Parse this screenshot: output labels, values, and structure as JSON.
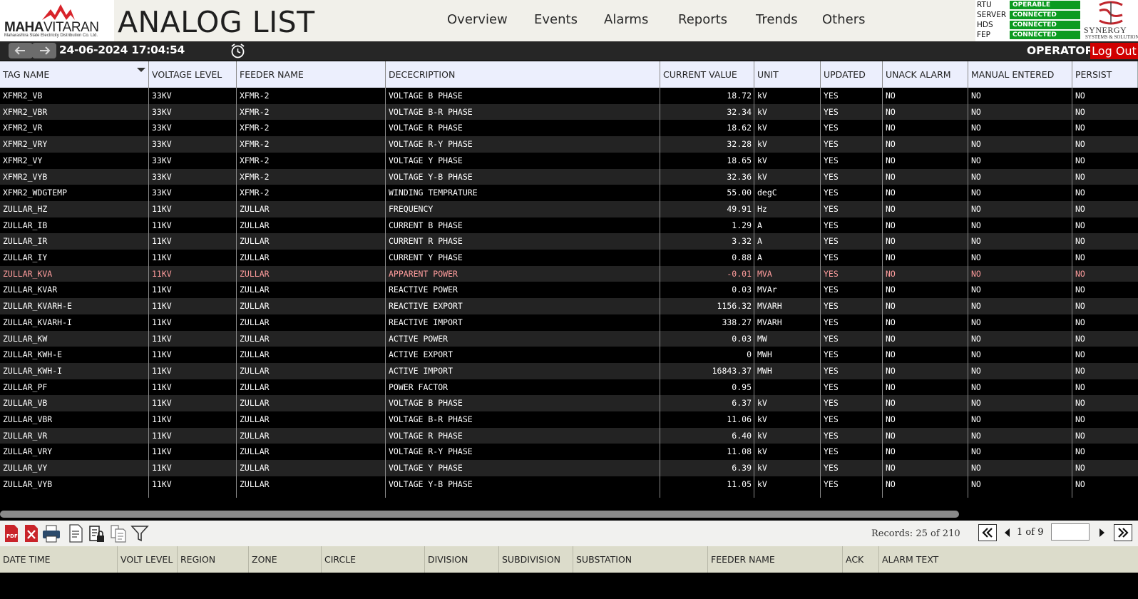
{
  "header": {
    "logo": {
      "brand_bold": "MAHA",
      "brand_light": "VITARAN",
      "subtitle": "Maharashtra State Electricity Distribution Co. Ltd."
    },
    "page_title": "ANALOG LIST",
    "nav": [
      "Overview",
      "Events",
      "Alarms",
      "Reports",
      "Trends",
      "Others"
    ],
    "status": [
      {
        "label": "RTU",
        "value": "OPERABLE"
      },
      {
        "label": "SERVER",
        "value": "CONNECTED"
      },
      {
        "label": "HDS",
        "value": "CONNECTED"
      },
      {
        "label": "FEP",
        "value": "CONNECTED"
      }
    ],
    "vendor": {
      "name": "Synergy",
      "subtitle": "Systems & Solutions"
    }
  },
  "subbar": {
    "datetime": "24-06-2024 17:04:54",
    "user_role": "OPERATOR",
    "logout_label": "Log Out"
  },
  "table": {
    "columns": [
      "TAG NAME",
      "VOLTAGE LEVEL",
      "FEEDER NAME",
      "DECECRIPTION",
      "CURRENT VALUE",
      "UNIT",
      "UPDATED",
      "UNACK ALARM",
      "MANUAL ENTERED",
      "PERSIST"
    ],
    "rows": [
      [
        "XFMR2_VB",
        "33KV",
        "XFMR-2",
        "VOLTAGE B PHASE",
        "18.72",
        "kV",
        "YES",
        "NO",
        "NO",
        "NO"
      ],
      [
        "XFMR2_VBR",
        "33KV",
        "XFMR-2",
        "VOLTAGE B-R PHASE",
        "32.34",
        "kV",
        "YES",
        "NO",
        "NO",
        "NO"
      ],
      [
        "XFMR2_VR",
        "33KV",
        "XFMR-2",
        "VOLTAGE R PHASE",
        "18.62",
        "kV",
        "YES",
        "NO",
        "NO",
        "NO"
      ],
      [
        "XFMR2_VRY",
        "33KV",
        "XFMR-2",
        "VOLTAGE R-Y PHASE",
        "32.28",
        "kV",
        "YES",
        "NO",
        "NO",
        "NO"
      ],
      [
        "XFMR2_VY",
        "33KV",
        "XFMR-2",
        "VOLTAGE Y PHASE",
        "18.65",
        "kV",
        "YES",
        "NO",
        "NO",
        "NO"
      ],
      [
        "XFMR2_VYB",
        "33KV",
        "XFMR-2",
        "VOLTAGE Y-B PHASE",
        "32.36",
        "kV",
        "YES",
        "NO",
        "NO",
        "NO"
      ],
      [
        "XFMR2_WDGTEMP",
        "33KV",
        "XFMR-2",
        "WINDING TEMPRATURE",
        "55.00",
        "degC",
        "YES",
        "NO",
        "NO",
        "NO"
      ],
      [
        "ZULLAR_HZ",
        "11KV",
        "ZULLAR",
        "FREQUENCY",
        "49.91",
        "Hz",
        "YES",
        "NO",
        "NO",
        "NO"
      ],
      [
        "ZULLAR_IB",
        "11KV",
        "ZULLAR",
        "CURRENT B PHASE",
        "1.29",
        "A",
        "YES",
        "NO",
        "NO",
        "NO"
      ],
      [
        "ZULLAR_IR",
        "11KV",
        "ZULLAR",
        "CURRENT R PHASE",
        "3.32",
        "A",
        "YES",
        "NO",
        "NO",
        "NO"
      ],
      [
        "ZULLAR_IY",
        "11KV",
        "ZULLAR",
        "CURRENT Y PHASE",
        "0.88",
        "A",
        "YES",
        "NO",
        "NO",
        "NO"
      ],
      [
        "ZULLAR_KVA",
        "11KV",
        "ZULLAR",
        "APPARENT POWER",
        "-0.01",
        "MVA",
        "YES",
        "NO",
        "NO",
        "NO"
      ],
      [
        "ZULLAR_KVAR",
        "11KV",
        "ZULLAR",
        "REACTIVE POWER",
        "0.03",
        "MVAr",
        "YES",
        "NO",
        "NO",
        "NO"
      ],
      [
        "ZULLAR_KVARH-E",
        "11KV",
        "ZULLAR",
        "REACTIVE EXPORT",
        "1156.32",
        "MVARH",
        "YES",
        "NO",
        "NO",
        "NO"
      ],
      [
        "ZULLAR_KVARH-I",
        "11KV",
        "ZULLAR",
        "REACTIVE IMPORT",
        "338.27",
        "MVARH",
        "YES",
        "NO",
        "NO",
        "NO"
      ],
      [
        "ZULLAR_KW",
        "11KV",
        "ZULLAR",
        "ACTIVE POWER",
        "0.03",
        "MW",
        "YES",
        "NO",
        "NO",
        "NO"
      ],
      [
        "ZULLAR_KWH-E",
        "11KV",
        "ZULLAR",
        "ACTIVE EXPORT",
        "0",
        "MWH",
        "YES",
        "NO",
        "NO",
        "NO"
      ],
      [
        "ZULLAR_KWH-I",
        "11KV",
        "ZULLAR",
        "ACTIVE IMPORT",
        "16843.37",
        "MWH",
        "YES",
        "NO",
        "NO",
        "NO"
      ],
      [
        "ZULLAR_PF",
        "11KV",
        "ZULLAR",
        "POWER FACTOR",
        "0.95",
        "",
        "YES",
        "NO",
        "NO",
        "NO"
      ],
      [
        "ZULLAR_VB",
        "11KV",
        "ZULLAR",
        "VOLTAGE B PHASE",
        "6.37",
        "kV",
        "YES",
        "NO",
        "NO",
        "NO"
      ],
      [
        "ZULLAR_VBR",
        "11KV",
        "ZULLAR",
        "VOLTAGE B-R PHASE",
        "11.06",
        "kV",
        "YES",
        "NO",
        "NO",
        "NO"
      ],
      [
        "ZULLAR_VR",
        "11KV",
        "ZULLAR",
        "VOLTAGE R PHASE",
        "6.40",
        "kV",
        "YES",
        "NO",
        "NO",
        "NO"
      ],
      [
        "ZULLAR_VRY",
        "11KV",
        "ZULLAR",
        "VOLTAGE R-Y PHASE",
        "11.08",
        "kV",
        "YES",
        "NO",
        "NO",
        "NO"
      ],
      [
        "ZULLAR_VY",
        "11KV",
        "ZULLAR",
        "VOLTAGE Y PHASE",
        "6.39",
        "kV",
        "YES",
        "NO",
        "NO",
        "NO"
      ],
      [
        "ZULLAR_VYB",
        "11KV",
        "ZULLAR",
        "VOLTAGE Y-B PHASE",
        "11.05",
        "kV",
        "YES",
        "NO",
        "NO",
        "NO"
      ]
    ],
    "alarm_row_index": 11,
    "alarm_row_color": "#ff9d9d"
  },
  "toolbar": {
    "icons": [
      "pdf-icon",
      "excel-icon",
      "print-icon",
      "report-icon",
      "lock-report-icon",
      "copy-icon",
      "filter-icon"
    ],
    "records_label": "Records:",
    "records_shown": "25",
    "records_of": "of",
    "records_total": "210",
    "page_current": "1",
    "page_of": "of",
    "page_total": "9",
    "page_input": ""
  },
  "alarm_table": {
    "columns": [
      "DATE TIME",
      "VOLT LEVEL",
      "REGION",
      "ZONE",
      "CIRCLE",
      "DIVISION",
      "SUBDIVISION",
      "SUBSTATION",
      "FEEDER NAME",
      "ACK",
      "ALARM TEXT"
    ]
  },
  "colors": {
    "status_ok": "#0c9b20",
    "logout": "#d00000",
    "brand_red": "#d8232a"
  }
}
